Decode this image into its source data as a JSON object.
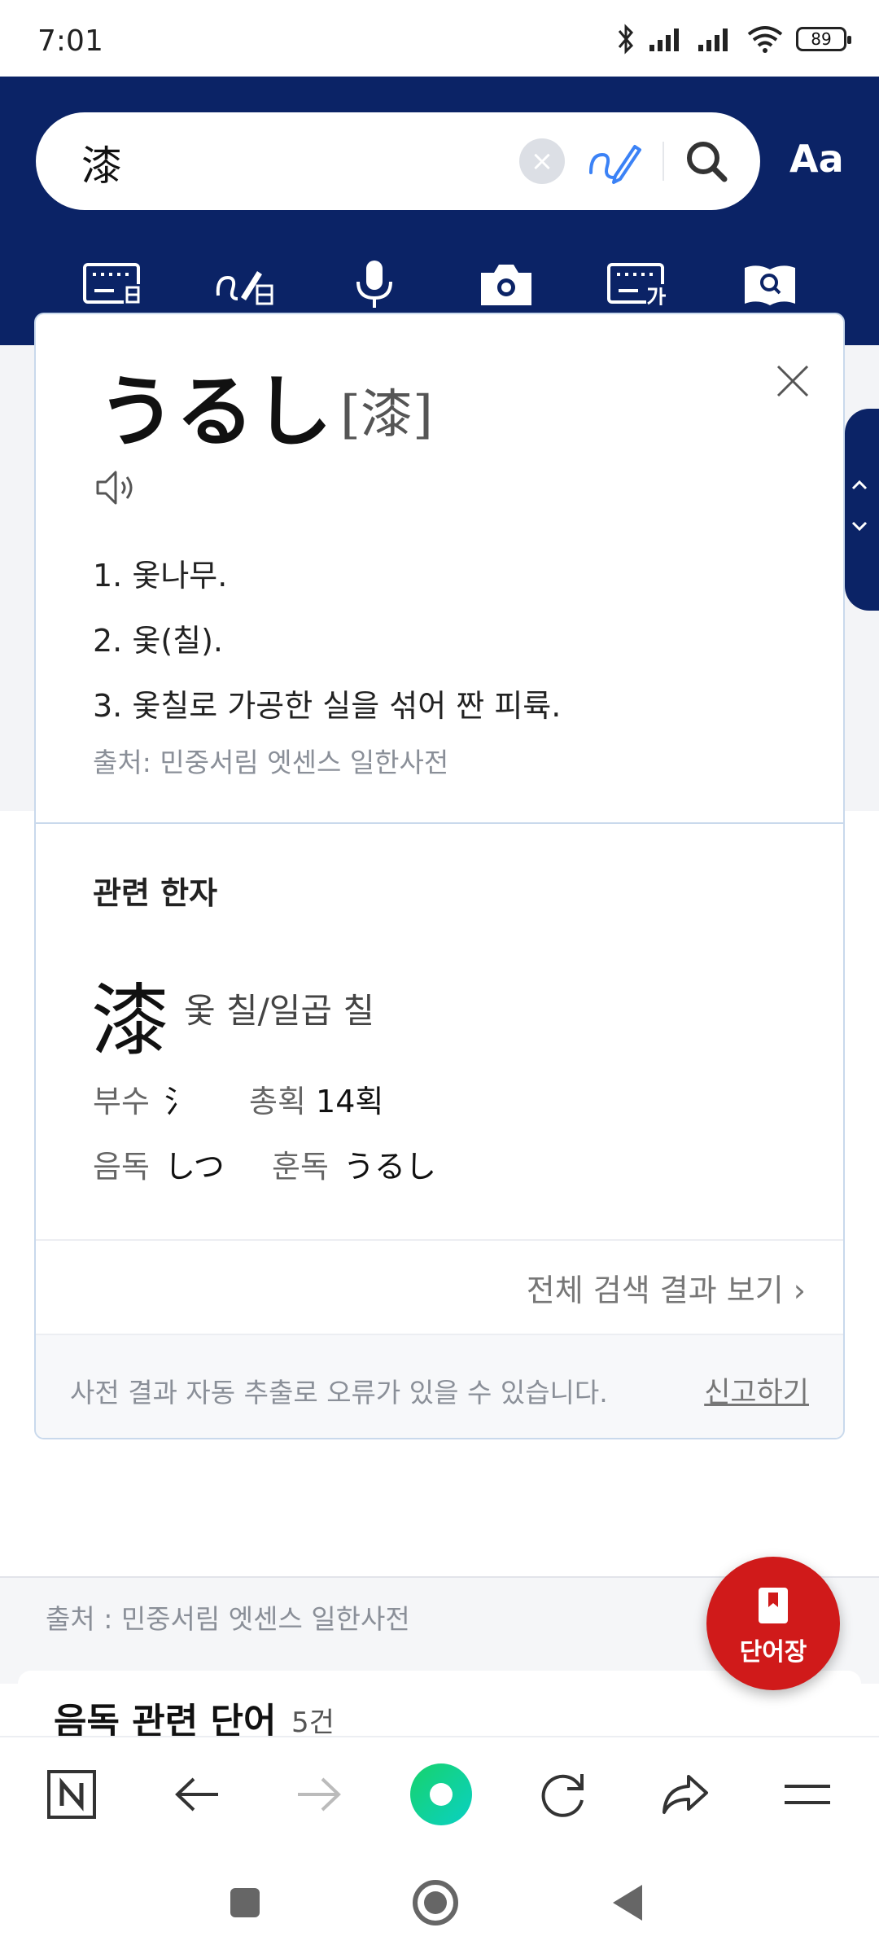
{
  "status_bar": {
    "time": "7:01",
    "battery": "89"
  },
  "search": {
    "query": "漆",
    "font_button": "Aa"
  },
  "popup": {
    "word": "うるし",
    "kanji": "[漆]",
    "definitions": [
      {
        "num": "1.",
        "text": "옻나무."
      },
      {
        "num": "2.",
        "text": "옻(칠)."
      },
      {
        "num": "3.",
        "text": "옻칠로 가공한 실을 섞어 짠 피륙."
      }
    ],
    "source": "출처: 민중서림 엣센스 일한사전",
    "hanja_heading": "관련 한자",
    "hanja": {
      "char": "漆",
      "meaning": "옻 칠/일곱 칠",
      "radical_label": "부수",
      "radical": "氵",
      "strokes_label": "총획",
      "strokes": "14획",
      "on_label": "음독",
      "on": "しつ",
      "kun_label": "훈독",
      "kun": "うるし"
    },
    "view_all": "전체 검색 결과 보기 ›",
    "disclaimer": "사전 결과 자동 추출로 오류가 있을 수 있습니다.",
    "report": "신고하기"
  },
  "background": {
    "source": "출처 : 민중서림 엣센스 일한사전",
    "related_title": "음독 관련 단어",
    "related_count": "5건"
  },
  "fab": {
    "label": "단어장"
  },
  "colors": {
    "header": "#0b2366",
    "accent": "#d01a1a",
    "handwrite": "#3b82f6"
  },
  "icons": {
    "toolbar": [
      "keyboard-hanja-icon",
      "handwriting-hanja-icon",
      "microphone-icon",
      "camera-icon",
      "keyboard-hangul-icon",
      "dictionary-icon"
    ],
    "browser": [
      "naver-icon",
      "back-icon",
      "forward-icon",
      "home-icon",
      "refresh-icon",
      "share-icon",
      "menu-icon"
    ],
    "nav": [
      "recents-icon",
      "home-nav-icon",
      "back-nav-icon"
    ]
  }
}
